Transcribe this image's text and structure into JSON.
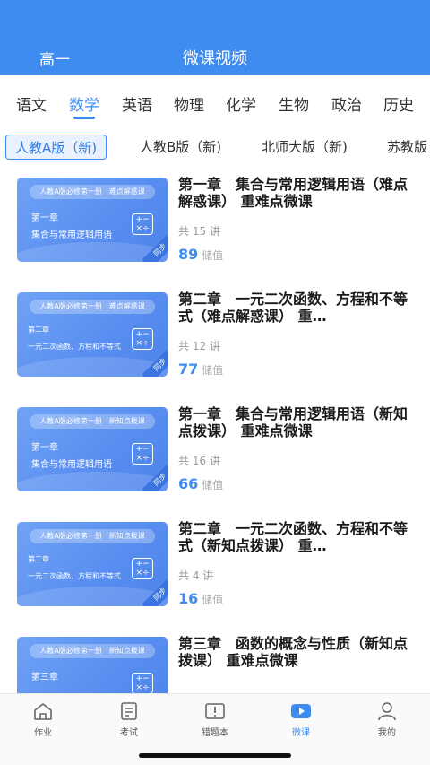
{
  "header": {
    "grade": "高一",
    "title": "微课视频"
  },
  "subjects": [
    "语文",
    "数学",
    "英语",
    "物理",
    "化学",
    "生物",
    "政治",
    "历史"
  ],
  "active_subject": 1,
  "editions": [
    "人教A版（新)",
    "人教B版（新)",
    "北师大版（新)",
    "苏教版"
  ],
  "colors": {
    "accent": "#3f8cf0",
    "card": "#5a8ff0"
  },
  "courses": [
    {
      "badge": "人教A版必修第一册　难点解惑课",
      "thumb_line1": "第一章",
      "thumb_line2": "集合与常用逻辑用语",
      "corner": "同步",
      "title": "第一章　集合与常用逻辑用语（难点解惑课） 重难点微课",
      "lessons": "共 15 讲",
      "points": "89",
      "points_unit": "储值"
    },
    {
      "badge": "人教A版必修第一册　难点解惑课",
      "thumb_line1": "第二章",
      "thumb_line2": "一元二次函数、方程和不等式",
      "corner": "同步",
      "title": "第二章　一元二次函数、方程和不等式（难点解惑课） 重…",
      "lessons": "共 12 讲",
      "points": "77",
      "points_unit": "储值"
    },
    {
      "badge": "人教A版必修第一册　新知点拨课",
      "thumb_line1": "第一章",
      "thumb_line2": "集合与常用逻辑用语",
      "corner": "同步",
      "title": "第一章　集合与常用逻辑用语（新知点拨课） 重难点微课",
      "lessons": "共 16 讲",
      "points": "66",
      "points_unit": "储值"
    },
    {
      "badge": "人教A版必修第一册　新知点拨课",
      "thumb_line1": "第二章",
      "thumb_line2": "一元二次函数、方程和不等式",
      "corner": "同步",
      "title": "第二章　一元二次函数、方程和不等式（新知点拨课） 重…",
      "lessons": "共 4 讲",
      "points": "16",
      "points_unit": "储值"
    },
    {
      "badge": "人教A版必修第一册　新知点拨课",
      "thumb_line1": "第三章",
      "thumb_line2": "",
      "corner": "同步",
      "title": "第三章　函数的概念与性质（新知点拨课） 重难点微课",
      "lessons": "",
      "points": "",
      "points_unit": ""
    }
  ],
  "nav": [
    {
      "label": "作业",
      "icon": "home-icon"
    },
    {
      "label": "考试",
      "icon": "exam-icon"
    },
    {
      "label": "错题本",
      "icon": "notebook-icon"
    },
    {
      "label": "微课",
      "icon": "video-icon"
    },
    {
      "label": "我的",
      "icon": "person-icon"
    }
  ],
  "active_nav": 3
}
